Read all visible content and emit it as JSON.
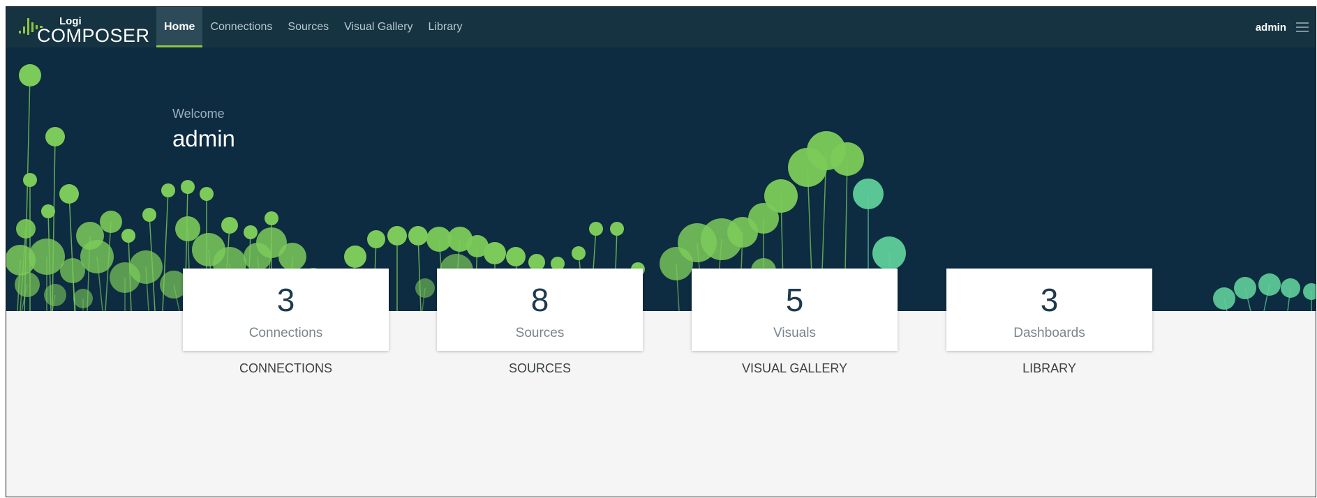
{
  "app": {
    "logo_small": "Logi",
    "logo_main": "COMPOSER"
  },
  "nav": {
    "items": [
      {
        "label": "Home",
        "active": true
      },
      {
        "label": "Connections",
        "active": false
      },
      {
        "label": "Sources",
        "active": false
      },
      {
        "label": "Visual Gallery",
        "active": false
      },
      {
        "label": "Library",
        "active": false
      }
    ],
    "user": "admin",
    "menu_icon": "hamburger-menu-icon"
  },
  "hero": {
    "welcome": "Welcome",
    "name": "admin"
  },
  "cards": [
    {
      "count": "3",
      "label": "Connections",
      "caption": "CONNECTIONS"
    },
    {
      "count": "8",
      "label": "Sources",
      "caption": "SOURCES"
    },
    {
      "count": "5",
      "label": "Visuals",
      "caption": "VISUAL GALLERY"
    },
    {
      "count": "3",
      "label": "Dashboards",
      "caption": "LIBRARY"
    }
  ],
  "colors": {
    "nav_bg": "#163341",
    "hero_bg": "#0d2b41",
    "accent_green": "#8dc63f",
    "bubble_green": "#7ccb5a",
    "bubble_teal": "#5fcf9a"
  }
}
